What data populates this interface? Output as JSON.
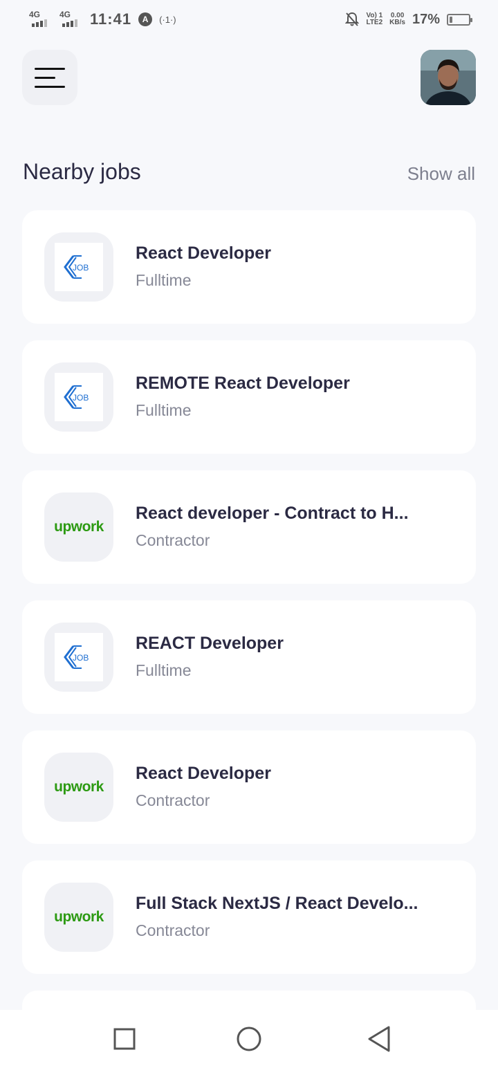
{
  "status_bar": {
    "signal1_label": "4G",
    "signal2_label": "4G",
    "time": "11:41",
    "vpn_icon": "A",
    "hotspot": "(·1·)",
    "volte_line1": "Vo) 1",
    "volte_line2": "LTE2",
    "speed_line1": "0.00",
    "speed_line2": "KB/s",
    "battery_percent": "17%",
    "battery_level": 0.17
  },
  "header": {
    "menu_icon": "hamburger-menu-icon",
    "avatar_icon": "user-avatar"
  },
  "section": {
    "title": "Nearby jobs",
    "show_all_label": "Show all"
  },
  "jobs": [
    {
      "title": "React Developer",
      "type": "Fulltime",
      "logo": "job-logo"
    },
    {
      "title": "REMOTE React Developer",
      "type": "Fulltime",
      "logo": "job-logo"
    },
    {
      "title": "React developer - Contract to H...",
      "type": "Contractor",
      "logo": "upwork",
      "logo_text": "upwork"
    },
    {
      "title": "REACT Developer",
      "type": "Fulltime",
      "logo": "job-logo"
    },
    {
      "title": "React Developer",
      "type": "Contractor",
      "logo": "upwork",
      "logo_text": "upwork"
    },
    {
      "title": "Full Stack NextJS / React Develo...",
      "type": "Contractor",
      "logo": "upwork",
      "logo_text": "upwork"
    }
  ],
  "nav_bar": {
    "recent_icon": "square-icon",
    "home_icon": "circle-icon",
    "back_icon": "triangle-back-icon"
  },
  "colors": {
    "background": "#f7f8fb",
    "card": "#ffffff",
    "title_text": "#2b2a43",
    "muted_text": "#868896",
    "upwork_green": "#2c9a12",
    "job_logo_blue": "#1f6fd1"
  }
}
